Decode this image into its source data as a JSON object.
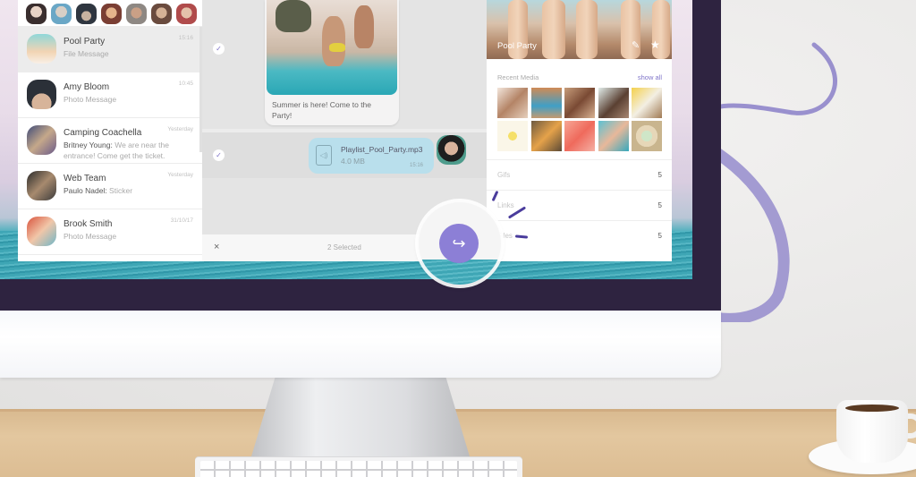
{
  "chat_list": {
    "story_avatars": [
      "contact-1",
      "contact-2",
      "contact-3",
      "contact-4",
      "contact-5",
      "contact-6",
      "contact-7"
    ],
    "chats": [
      {
        "name": "Pool Party",
        "sender": "",
        "preview": "File Message",
        "time": "15:16",
        "active": true
      },
      {
        "name": "Amy Bloom",
        "sender": "",
        "preview": "Photo Message",
        "time": "10:45",
        "active": false
      },
      {
        "name": "Camping Coachella",
        "sender": "Britney Young:",
        "preview": "We are near the entrance! Come get the ticket.",
        "time": "Yesterday",
        "active": false
      },
      {
        "name": "Web Team",
        "sender": "Paulo Nadel:",
        "preview": "Sticker",
        "time": "Yesterday",
        "active": false
      },
      {
        "name": "Brook Smith",
        "sender": "",
        "preview": "Photo Message",
        "time": "31/10/17",
        "active": false
      }
    ]
  },
  "conversation": {
    "photo_message": {
      "caption": "Summer is here! Come to the Party!",
      "selected": true
    },
    "file_message": {
      "file_name": "Playlist_Pool_Party.mp3",
      "file_size": "4.0 MB",
      "time": "15:16",
      "selected": true
    },
    "selection_bar": {
      "close_icon": "×",
      "count_label": "2 Selected"
    },
    "forward_icon": "↪"
  },
  "info_panel": {
    "group_name": "Pool Party",
    "edit_icon": "✎",
    "favorite_icon": "★",
    "recent_media_label": "Recent Media",
    "show_all_label": "show all",
    "media_thumbs": 10,
    "stats": [
      {
        "label": "Gifs",
        "value": "5"
      },
      {
        "label": "Links",
        "value": "5"
      },
      {
        "label": "Files",
        "value": "5"
      }
    ]
  },
  "colors": {
    "accent": "#8c7fd6",
    "link": "#7f74c9",
    "bezel": "#2e2340",
    "file_bubble": "#b9dfec"
  }
}
